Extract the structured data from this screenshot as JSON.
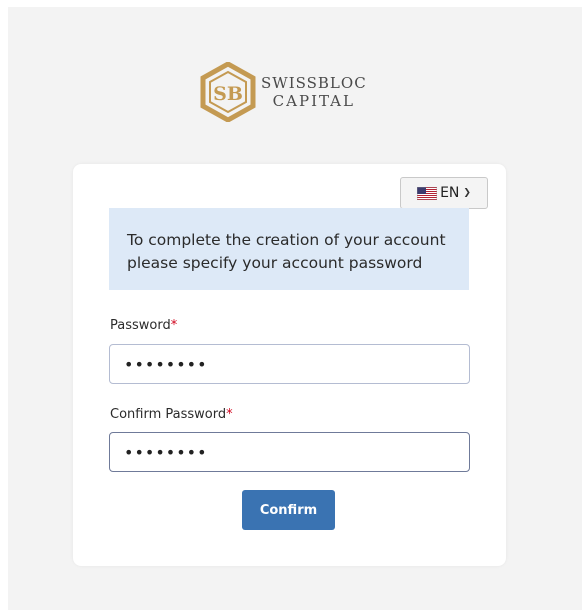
{
  "brand": {
    "line1": "SWISSBLOC",
    "line2": "CAPITAL",
    "mark_text": "SB",
    "mark_color": "#c49a52"
  },
  "language": {
    "selected": "EN",
    "flag_icon": "us-flag-icon",
    "chevron_icon": "chevron-down-icon"
  },
  "notice": {
    "text": "To complete the creation of your account please specify your account password"
  },
  "form": {
    "password_label": "Password",
    "password_value": "••••••••",
    "confirm_label": "Confirm Password",
    "confirm_value": "••••••••",
    "required_marker": "*",
    "submit_label": "Confirm"
  },
  "colors": {
    "accent": "#3a73b2",
    "notice_bg": "#dde9f7",
    "required": "#d0021b"
  }
}
